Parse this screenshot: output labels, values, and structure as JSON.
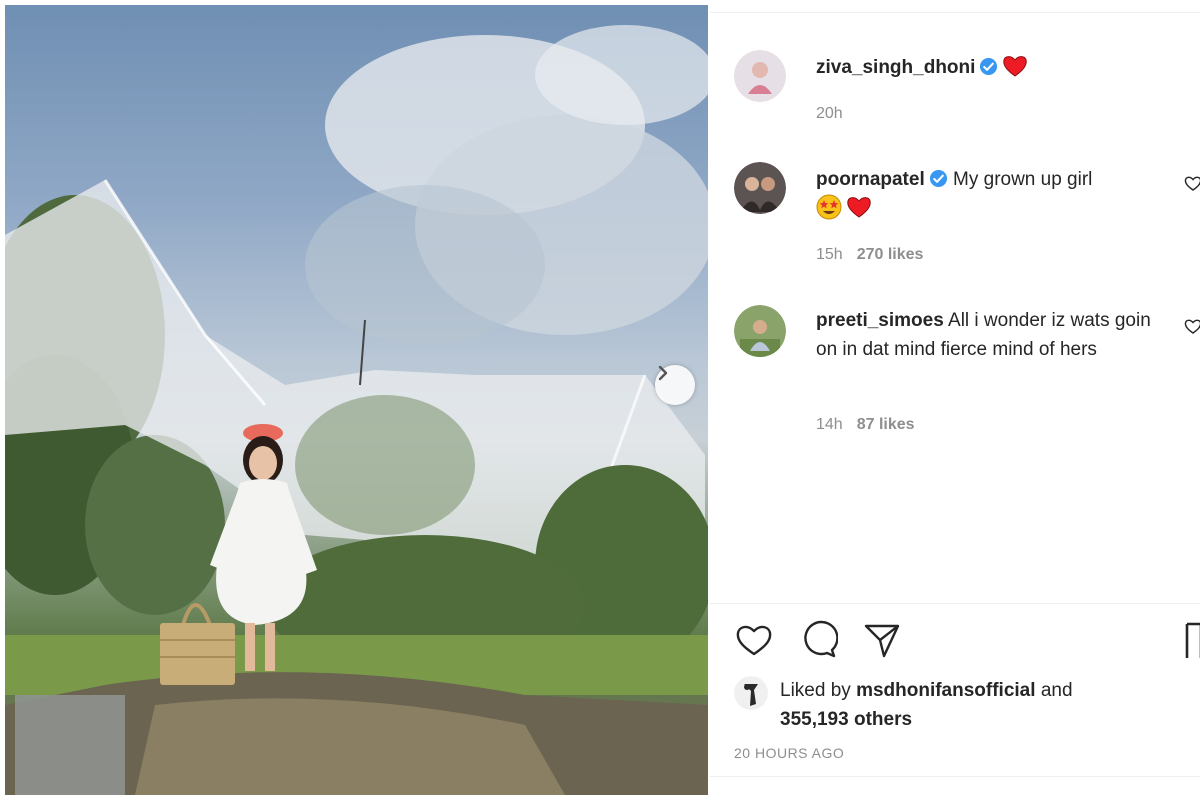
{
  "post": {
    "author": "ziva_singh_dhoni",
    "author_time": "20h",
    "author_emoji": "red-heart-icon"
  },
  "comments": [
    {
      "username": "poornapatel",
      "text": "My grown up girl",
      "emoji": [
        "star-struck-emoji-icon",
        "red-heart-icon"
      ],
      "time": "15h",
      "likes": "270 likes"
    },
    {
      "username": "preeti_simoes",
      "text": "All i wonder iz wats goin on in dat mind fierce mind of hers",
      "time": "14h",
      "likes": "87 likes"
    }
  ],
  "actions": {
    "icons": [
      "heart-outline-icon",
      "comment-icon",
      "share-icon",
      "bookmark-icon"
    ]
  },
  "liked_by": {
    "prefix": "Liked by",
    "user": "msdhonifansofficial",
    "conj": "and",
    "others": "355,193 others"
  },
  "timestamp": "20 HOURS AGO",
  "colors": {
    "verified": "#3897f0",
    "heart": "#ed1c24",
    "muted": "#8e8e8e"
  }
}
